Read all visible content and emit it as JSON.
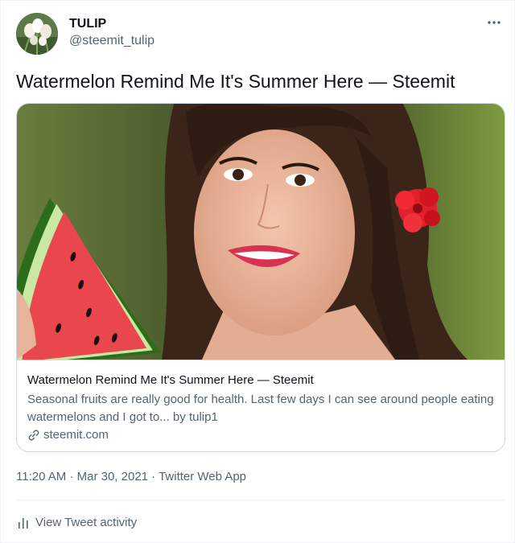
{
  "author": {
    "display_name": "TULIP",
    "handle": "@steemit_tulip",
    "avatar_icon": "tulip-avatar"
  },
  "tweet": {
    "text": "Watermelon Remind Me It's Summer Here — Steemit"
  },
  "card": {
    "image_icon": "woman-with-watermelon-photo",
    "title": "Watermelon Remind Me It's Summer Here — Steemit",
    "description": "Seasonal fruits are really good for health. Last few days I can see around people eating watermelons and I got to... by tulip1",
    "domain": "steemit.com"
  },
  "meta": {
    "time": "11:20 AM",
    "separator": "·",
    "date": "Mar 30, 2021",
    "source": "Twitter Web App"
  },
  "activity": {
    "label": "View Tweet activity"
  },
  "colors": {
    "text_primary": "#0f1419",
    "text_secondary": "#536471",
    "border": "#cfd9de",
    "divider": "#eff3f4"
  }
}
